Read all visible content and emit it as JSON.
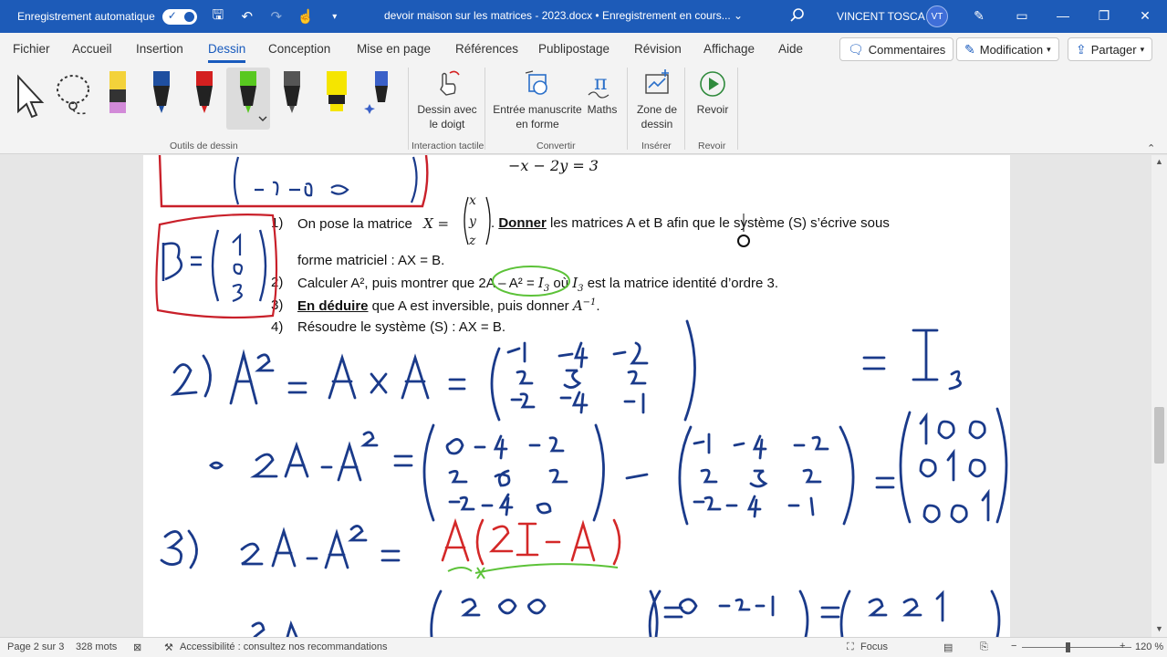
{
  "titlebar": {
    "autosave_label": "Enregistrement automatique",
    "doc_title": "devoir maison sur les matrices - 2023.docx • Enregistrement en cours... ⌄",
    "user_name": "VINCENT TOSCA",
    "user_initials": "VT"
  },
  "tabs": [
    "Fichier",
    "Accueil",
    "Insertion",
    "Dessin",
    "Conception",
    "Mise en page",
    "Références",
    "Publipostage",
    "Révision",
    "Affichage",
    "Aide"
  ],
  "active_tab": "Dessin",
  "actions": {
    "comments": "Commentaires",
    "editing": "Modification",
    "share": "Partager"
  },
  "ribbon": {
    "groups": {
      "drawing_tools": "Outils de dessin",
      "touch": "Interaction tactile",
      "convert": "Convertir",
      "insert": "Insérer",
      "replay": "Revoir"
    },
    "buttons": {
      "finger_draw_l1": "Dessin avec",
      "finger_draw_l2": "le doigt",
      "ink_to_shape_l1": "Entrée manuscrite",
      "ink_to_shape_l2": "en forme",
      "math": "Maths",
      "canvas_l1": "Zone de",
      "canvas_l2": "dessin",
      "replay": "Revoir"
    },
    "pen_colors": [
      "#f3d23a",
      "#1f4fa0",
      "#d42020",
      "#58c820",
      "#555555",
      "#f5e500",
      "#3a60c8"
    ]
  },
  "document": {
    "q1_num": "1)",
    "q1_text_a": "On pose la matrice",
    "q1_math": "X =",
    "q1_vec": [
      "x",
      "y",
      "z"
    ],
    "q1_bold": "Donner",
    "q1_text_b": " les matrices A et B afin que le système (S) s’écrive sous",
    "q1_text_c": "forme matriciel : AX = B.",
    "q2_num": "2)",
    "q2_text": "Calculer A², puis montrer que 2A – A² = ",
    "q2_math": "I",
    "q2_sub": "3",
    "q2_text_b": " où ",
    "q2_math_b": "I",
    "q2_sub_b": "3",
    "q2_text_c": " est la matrice identité d’ordre 3.",
    "q3_num": "3)",
    "q3_bold": "En déduire",
    "q3_text": " que A est inversible, puis donner ",
    "q3_math": "A",
    "q3_sup": "−1",
    "q3_end": ".",
    "q4_num": "4)",
    "q4_text": "Résoudre le système (S) : AX = B.",
    "system_row": "−x − 2y    =   3"
  },
  "status": {
    "page": "Page 2 sur 3",
    "words": "328 mots",
    "accessibility": "Accessibilité : consultez nos recommandations",
    "focus": "Focus",
    "zoom": "120 %"
  }
}
